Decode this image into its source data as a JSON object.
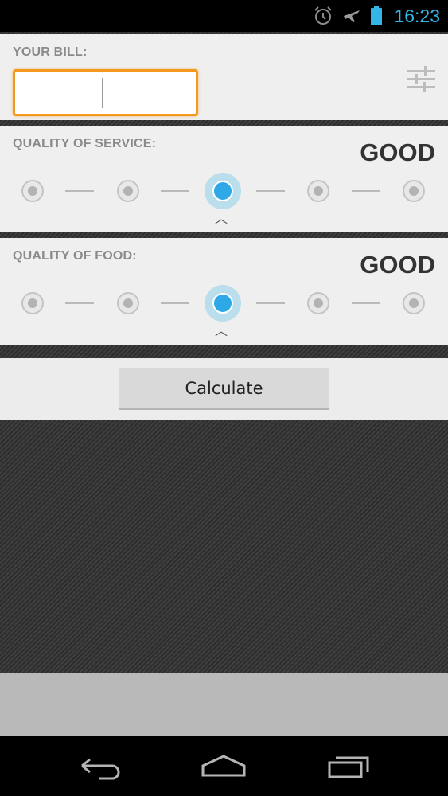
{
  "status_bar": {
    "time": "16:23",
    "icons": [
      "alarm-icon",
      "airplane-mode-icon",
      "battery-icon"
    ],
    "accent_color": "#33b5e5"
  },
  "bill": {
    "label": "YOUR BILL:",
    "value": "",
    "focused": true,
    "settings_icon": "settings-sliders-icon"
  },
  "service": {
    "label": "QUALITY OF SERVICE:",
    "rating_text": "GOOD",
    "steps": 5,
    "selected_index": 2
  },
  "food": {
    "label": "QUALITY OF FOOD:",
    "rating_text": "GOOD",
    "steps": 5,
    "selected_index": 2
  },
  "actions": {
    "calculate_label": "Calculate"
  },
  "nav": {
    "icons": [
      "back-icon",
      "home-icon",
      "recent-apps-icon"
    ]
  },
  "colors": {
    "focus_border": "#f39a1e",
    "slider_active": "#2ea8e6",
    "panel_bg": "#efefef"
  }
}
